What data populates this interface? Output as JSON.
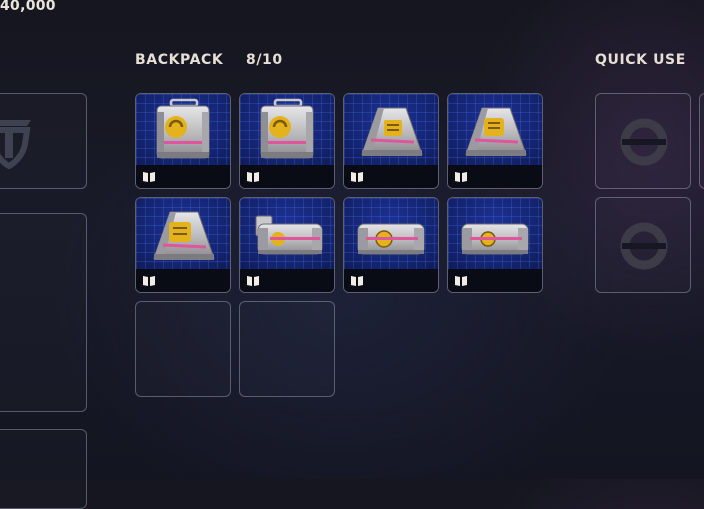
{
  "currency": {
    "amount": "40,000"
  },
  "backpack": {
    "title": "BACKPACK",
    "capacity": "8/10",
    "items": [
      {
        "icon": "supply-case-handled-icon"
      },
      {
        "icon": "supply-case-handled-icon"
      },
      {
        "icon": "supply-crate-trapezoid-icon"
      },
      {
        "icon": "supply-crate-trapezoid-icon"
      },
      {
        "icon": "supply-crate-trapezoid-icon"
      },
      {
        "icon": "supply-canister-long-icon"
      },
      {
        "icon": "supply-canister-long-icon"
      },
      {
        "icon": "supply-canister-long-icon"
      }
    ],
    "empty_slots": 2,
    "item_footer_icon": "open-book-icon"
  },
  "quick_use": {
    "title": "QUICK USE",
    "slot_icon": "ring-slot-icon"
  },
  "equipment": {
    "shield_icon": "emblem-shield-icon"
  },
  "colors": {
    "text": "#e7dfd6",
    "slot_border": "#afb4c8",
    "item_background": "#13246e",
    "accent_pink": "#e0569a",
    "accent_yellow": "#e3b21c"
  }
}
